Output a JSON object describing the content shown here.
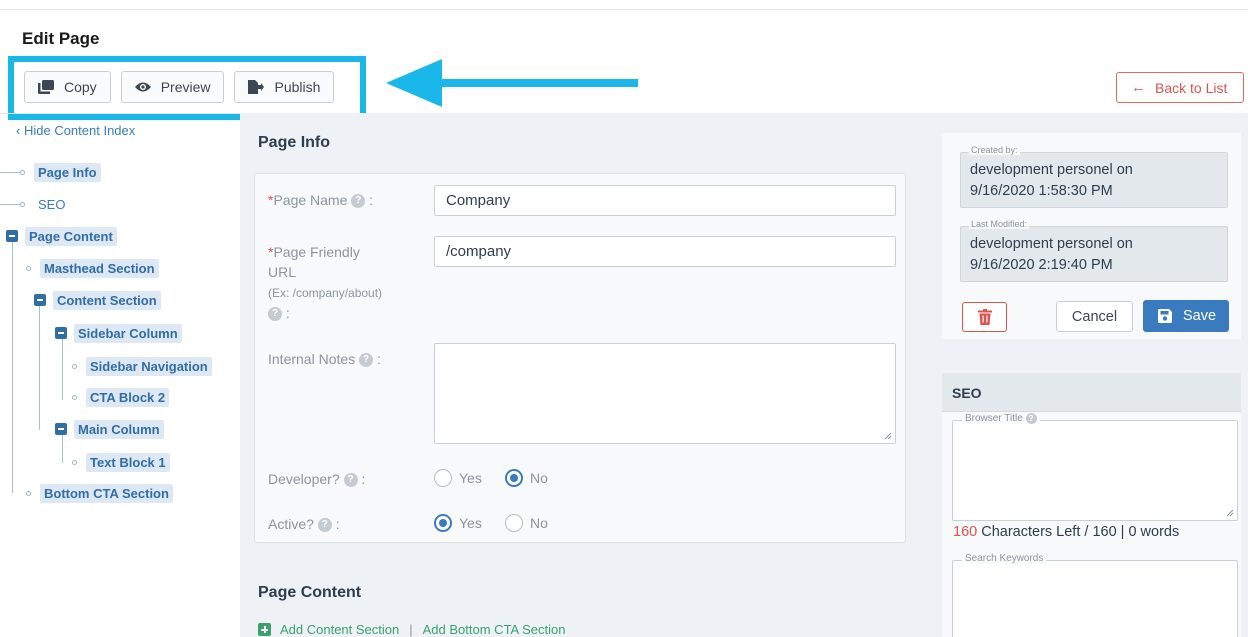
{
  "page": {
    "title": "Edit Page"
  },
  "toolbar": {
    "copy_label": "Copy",
    "preview_label": "Preview",
    "publish_label": "Publish",
    "back_label": "Back to List"
  },
  "content_index": {
    "hide_label": "Hide Content Index",
    "items": [
      {
        "label": "Page Info"
      },
      {
        "label": "SEO"
      },
      {
        "label": "Page Content"
      },
      {
        "label": "Masthead Section"
      },
      {
        "label": "Content Section"
      },
      {
        "label": "Sidebar Column"
      },
      {
        "label": "Sidebar Navigation"
      },
      {
        "label": "CTA Block 2"
      },
      {
        "label": "Main Column"
      },
      {
        "label": "Text Block 1"
      },
      {
        "label": "Bottom CTA Section"
      }
    ]
  },
  "page_info": {
    "heading": "Page Info",
    "page_name_label": "Page Name",
    "page_name_value": "Company",
    "friendly_url_label_1": "Page Friendly",
    "friendly_url_label_2": "URL",
    "friendly_url_hint": "(Ex: /company/about)",
    "friendly_url_value": "/company",
    "notes_label": "Internal Notes",
    "developer_label": "Developer?",
    "active_label": "Active?",
    "yes_label": "Yes",
    "no_label": "No",
    "developer_value": "No",
    "active_value": "Yes",
    "required_mark": "*",
    "colon": ":"
  },
  "page_content": {
    "heading": "Page Content",
    "add_content_section": "Add Content Section",
    "add_bottom_cta": "Add Bottom CTA Section",
    "separator": "|"
  },
  "meta": {
    "created_by_legend": "Created by:",
    "created_by_line1": "development personel on",
    "created_by_line2": "9/16/2020 1:58:30 PM",
    "modified_legend": "Last Modified:",
    "modified_line1": "development personel on",
    "modified_line2": "9/16/2020 2:19:40 PM",
    "cancel_label": "Cancel",
    "save_label": "Save"
  },
  "seo": {
    "heading": "SEO",
    "browser_title_legend": "Browser Title",
    "chars_left_count": "160",
    "chars_left_text": "Characters Left / 160 | 0 words",
    "keywords_legend": "Search Keywords"
  },
  "colors": {
    "highlight": "#1ab7ea",
    "primary": "#3a7bc0",
    "danger": "#d9534f",
    "success": "#3aa26a"
  }
}
